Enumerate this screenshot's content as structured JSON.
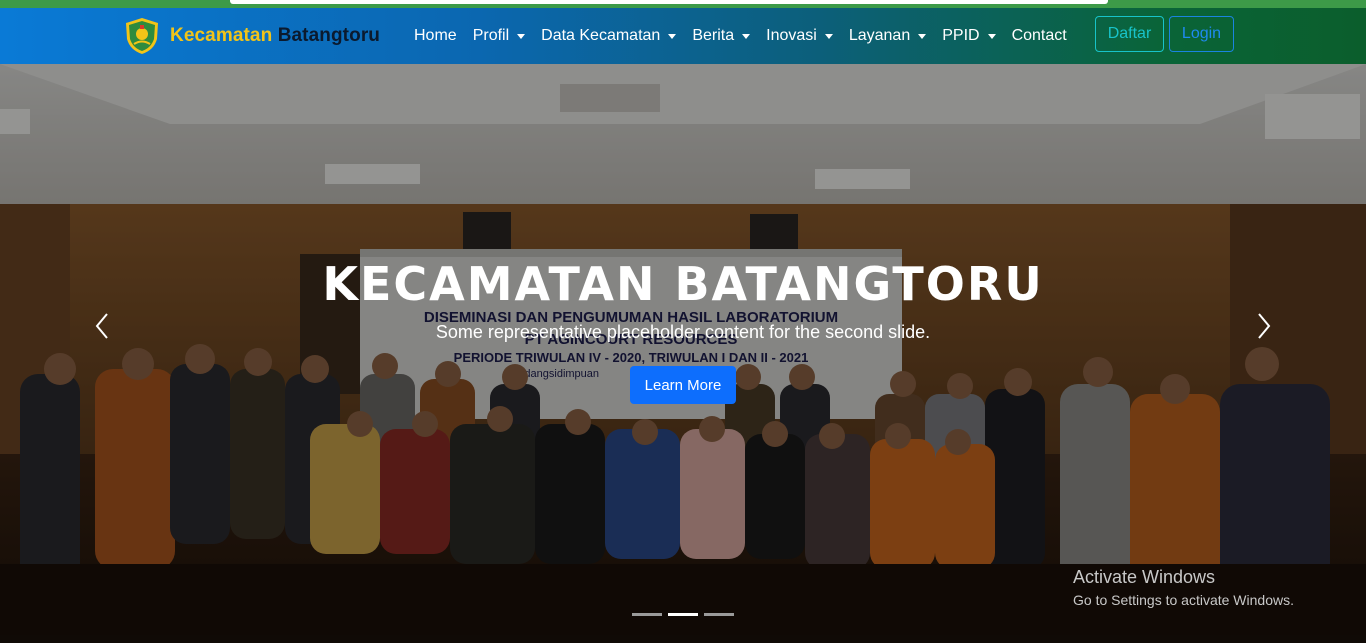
{
  "brand": {
    "name_part1": "Kecamatan",
    "name_part2": "Batangtoru",
    "logo_icon": "district-crest-icon"
  },
  "nav": {
    "items": [
      {
        "label": "Home",
        "dropdown": false
      },
      {
        "label": "Profil",
        "dropdown": true
      },
      {
        "label": "Data Kecamatan",
        "dropdown": true
      },
      {
        "label": "Berita",
        "dropdown": true
      },
      {
        "label": "Inovasi",
        "dropdown": true
      },
      {
        "label": "Layanan",
        "dropdown": true
      },
      {
        "label": "PPID",
        "dropdown": true
      },
      {
        "label": "Contact",
        "dropdown": false
      }
    ],
    "register_label": "Daftar",
    "login_label": "Login"
  },
  "hero": {
    "title": "KECAMATAN BATANGTORU",
    "subtitle": "Some representative placeholder content for the second slide.",
    "button_label": "Learn More",
    "banner": {
      "line1": "DISEMINASI DAN PENGUMUMAN HASIL LABORATORIUM",
      "line2": "PT AGINCOURT RESOURCES",
      "line3": "PERIODE TRIWULAN IV - 2020, TRIWULAN I DAN II - 2021",
      "line4": "Padangsidimpuan"
    },
    "slides_total": 3,
    "active_slide": 2
  },
  "os_watermark": {
    "title": "Activate Windows",
    "subtitle": "Go to Settings to activate Windows."
  },
  "colors": {
    "brand_yellow": "#f2c418",
    "primary_blue": "#0d6efd",
    "register_teal": "#18c3c9"
  }
}
